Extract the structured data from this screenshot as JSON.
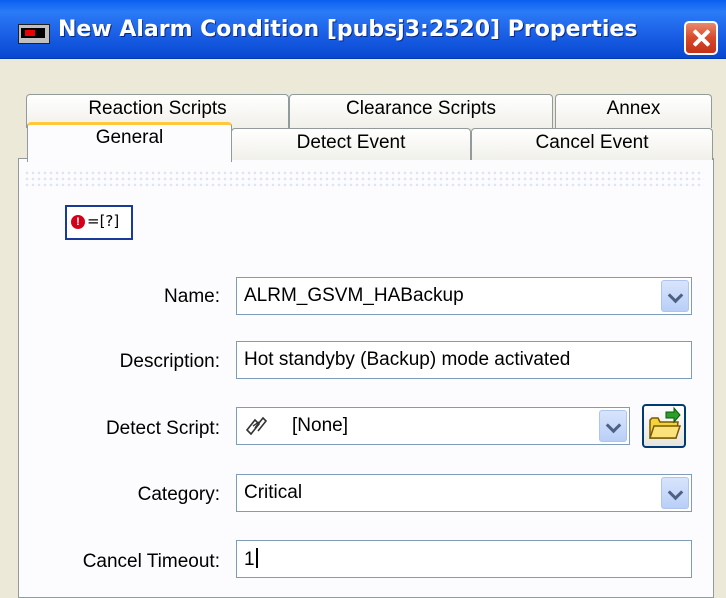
{
  "window": {
    "title": "New Alarm Condition [pubsj3:2520] Properties",
    "icon": "alarm-window-icon"
  },
  "tabs": {
    "row_back": [
      "Reaction Scripts",
      "Clearance Scripts",
      "Annex"
    ],
    "row_front": [
      "General",
      "Detect Event",
      "Cancel Event"
    ],
    "active": "General"
  },
  "general": {
    "condition_icon_text": "=[?]",
    "condition_icon_mark": "!",
    "name": {
      "label": "Name:",
      "value": "ALRM_GSVM_HABackup"
    },
    "description": {
      "label": "Description:",
      "value": "Hot standyby (Backup) mode activated"
    },
    "detect_script": {
      "label": "Detect Script:",
      "value": "[None]"
    },
    "category": {
      "label": "Category:",
      "value": "Critical"
    },
    "cancel_timeout": {
      "label": "Cancel Timeout:",
      "value": "1"
    }
  },
  "colors": {
    "title_bar": "#0a5ff0",
    "close_button": "#d8482a",
    "active_tab_accent": "#ffc83c",
    "field_border": "#7f9db9"
  }
}
